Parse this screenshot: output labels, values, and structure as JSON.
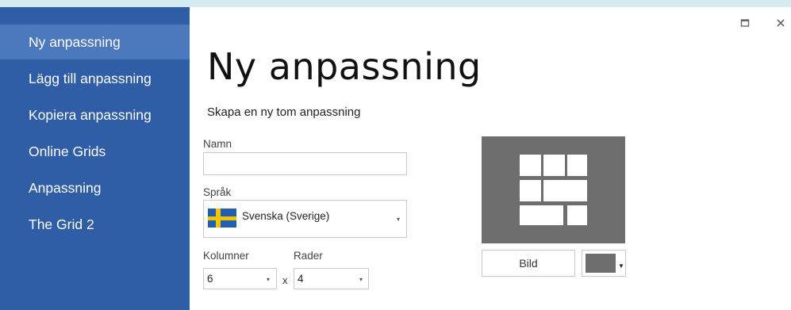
{
  "sidebar": {
    "items": [
      {
        "label": "Ny anpassning",
        "active": true
      },
      {
        "label": "Lägg till anpassning",
        "active": false
      },
      {
        "label": "Kopiera anpassning",
        "active": false
      },
      {
        "label": "Online Grids",
        "active": false
      },
      {
        "label": "Anpassning",
        "active": false
      },
      {
        "label": "The Grid 2",
        "active": false
      }
    ]
  },
  "window": {
    "maximize_icon": "maximize-icon",
    "close_icon": "close-icon"
  },
  "main": {
    "title": "Ny anpassning",
    "subtitle": "Skapa en ny tom anpassning",
    "name_label": "Namn",
    "name_value": "",
    "language_label": "Språk",
    "language_value": "Svenska (Sverige)",
    "language_flag": "sweden-flag-icon",
    "columns_label": "Kolumner",
    "columns_value": "6",
    "rows_label": "Rader",
    "rows_value": "4",
    "times_symbol": "x",
    "image_button_label": "Bild",
    "preview_color": "#6e6e6e",
    "accent_color": "#2f5ea6"
  }
}
